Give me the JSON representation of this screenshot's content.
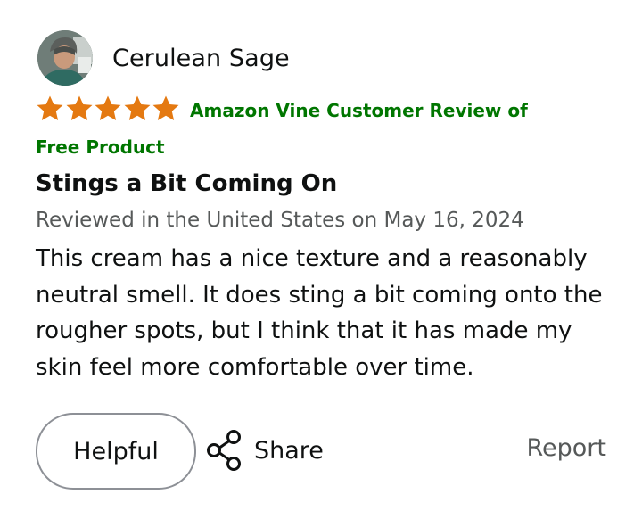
{
  "reviewer": {
    "name": "Cerulean Sage",
    "avatar_icon": "profile-photo"
  },
  "rating": {
    "stars": 5,
    "max": 5,
    "star_color": "#e47911"
  },
  "badge": {
    "text": "Amazon Vine Customer Review of Free Product",
    "color": "#007600"
  },
  "review": {
    "title": "Stings a Bit Coming On",
    "meta": "Reviewed in the United States on May 16, 2024",
    "body": "This cream has a nice texture and a reasonably neutral smell. It does sting a bit coming onto the rougher spots, but I think that it has made my skin feel more comfortable over time."
  },
  "actions": {
    "helpful_label": "Helpful",
    "share_label": "Share",
    "share_icon": "share-icon",
    "report_label": "Report"
  }
}
